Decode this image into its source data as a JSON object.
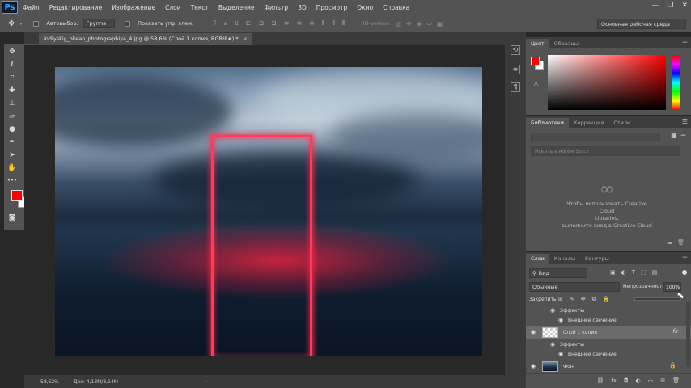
{
  "menubar": {
    "logo": "Ps",
    "items": [
      "Файл",
      "Редактирование",
      "Изображение",
      "Слои",
      "Текст",
      "Выделение",
      "Фильтр",
      "3D",
      "Просмотр",
      "Окно",
      "Справка"
    ],
    "window_controls": [
      "—",
      "❐",
      "✕"
    ]
  },
  "options": {
    "autoselect_label": "Автовыбор:",
    "autoselect_value": "Группа",
    "show_controls_label": "Показать упр. элем.",
    "mode_3d": "3D-режим:",
    "workspace": "Основная рабочая среда"
  },
  "document": {
    "tab_title": "indiyskiy_okean_photographiya_4.jpg @ 58,6% (Слой 1 копия, RGB/8#) *",
    "close": "×"
  },
  "status": {
    "zoom": "58,62%",
    "doc_info": "Док: 4,13M/8,14M",
    "arrow": "›"
  },
  "color_panel": {
    "tabs": [
      "Цвет",
      "Образцы"
    ],
    "fg_color": "#ff0000",
    "bg_color": "#ffffff"
  },
  "libraries_panel": {
    "tabs": [
      "Библиотеки",
      "Коррекция",
      "Стили"
    ],
    "search_placeholder": "Искать в Adobe Stock",
    "message_line1": "Чтобы использовать Creative Cloud",
    "message_line2": "Libraries,",
    "message_line3": "выполните вход в Creative Cloud"
  },
  "layers_panel": {
    "tabs": [
      "Слои",
      "Каналы",
      "Контуры"
    ],
    "kind_filter": "Вид",
    "blend_mode": "Обычные",
    "opacity_label": "Непрозрачность:",
    "opacity_value": "100%",
    "lock_label": "Закрепить:",
    "layers": [
      {
        "name": "Эффекты",
        "type": "effects"
      },
      {
        "name": "Внешнее свечение",
        "type": "effect"
      },
      {
        "name": "Слой 1 копия",
        "type": "layer",
        "selected": true,
        "fx": "fx"
      },
      {
        "name": "Эффекты",
        "type": "effects"
      },
      {
        "name": "Внешнее свечение",
        "type": "effect"
      },
      {
        "name": "Фон",
        "type": "background"
      }
    ]
  },
  "tools": {
    "icons": [
      "move-icon",
      "marquee-icon",
      "lasso-icon",
      "quick-select-icon",
      "crop-icon",
      "eyedropper-icon",
      "healing-icon",
      "brush-icon",
      "stamp-icon",
      "history-brush-icon",
      "eraser-icon",
      "gradient-icon",
      "blur-icon",
      "dodge-icon",
      "pen-icon",
      "type-icon",
      "path-select-icon",
      "shape-icon",
      "hand-icon",
      "zoom-icon"
    ],
    "more": "•••"
  },
  "colors": {
    "accent_ps": "#31a8ff",
    "portal_glow": "#ff3b55"
  }
}
